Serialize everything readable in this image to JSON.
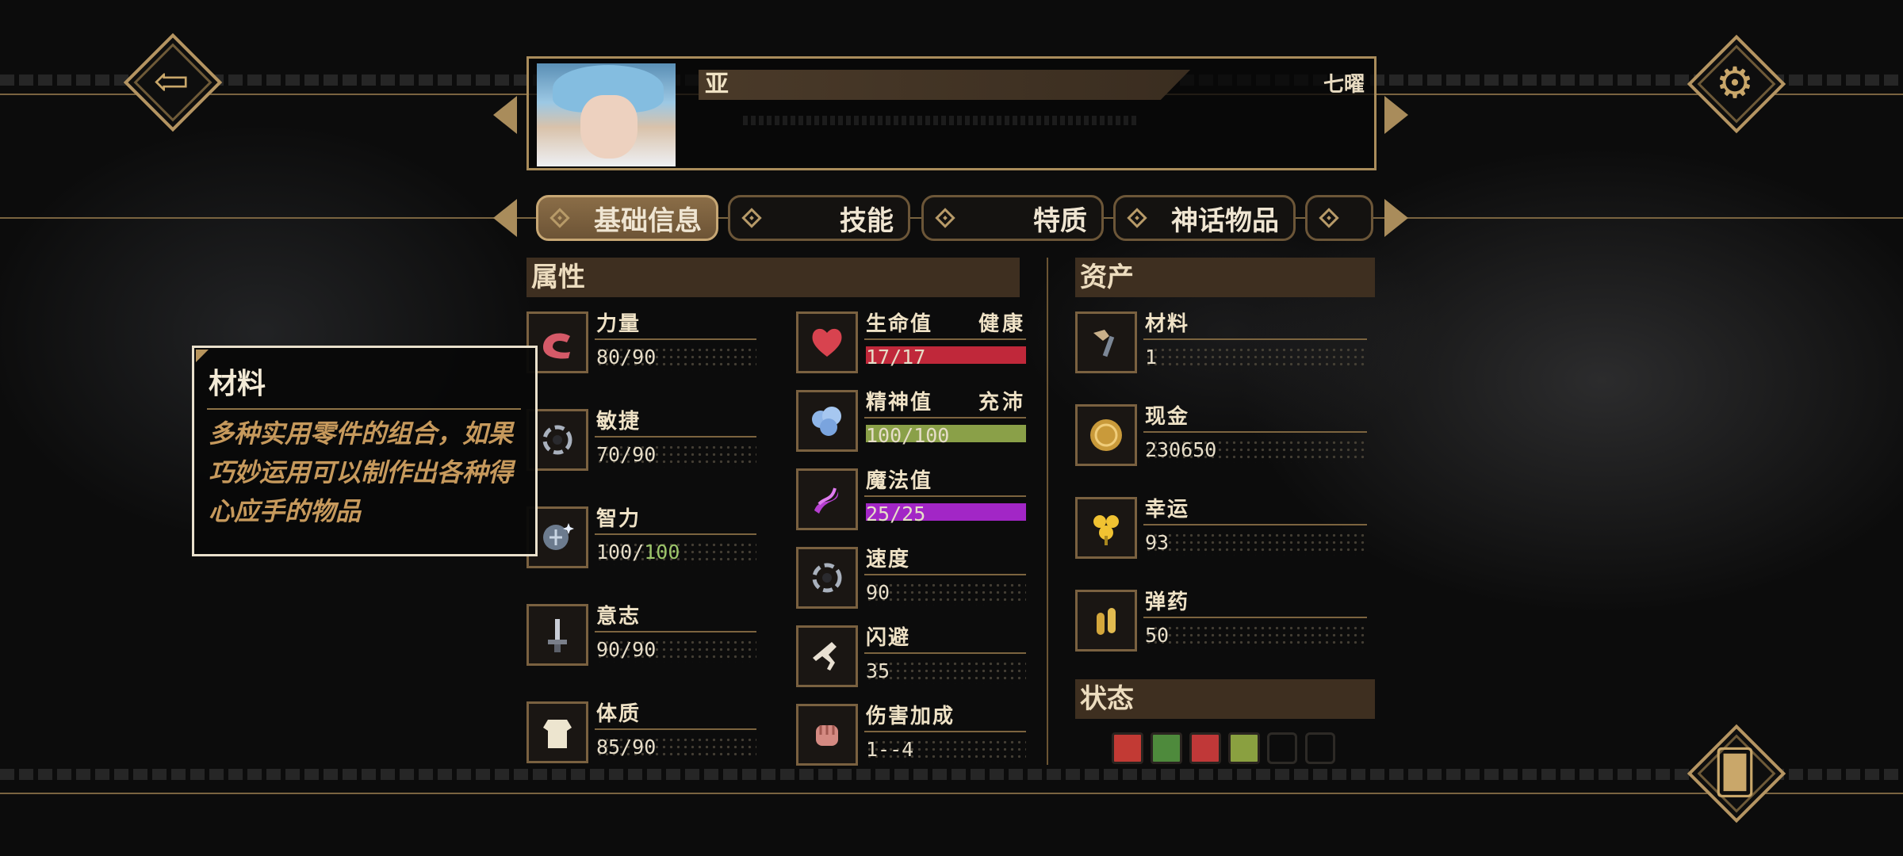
{
  "header": {
    "character_name": "亚",
    "day_label": "七曜"
  },
  "tabs": [
    {
      "label": "基础信息",
      "active": true
    },
    {
      "label": "技能",
      "active": false
    },
    {
      "label": "特质",
      "active": false
    },
    {
      "label": "神话物品",
      "active": false
    },
    {
      "label": "",
      "active": false
    }
  ],
  "attributes": {
    "title": "属性",
    "items": [
      {
        "label": "力量",
        "value": "80/90",
        "icon": "arm-icon"
      },
      {
        "label": "敏捷",
        "value": "70/90",
        "icon": "swirl-icon"
      },
      {
        "label": "智力",
        "value_current": "100/",
        "value_max": "100",
        "icon": "brain-icon"
      },
      {
        "label": "意志",
        "value": "90/90",
        "icon": "sword-icon"
      },
      {
        "label": "体质",
        "value": "85/90",
        "icon": "body-icon"
      }
    ]
  },
  "vitals": {
    "items": [
      {
        "label": "生命值",
        "status": "健康",
        "value": "17/17",
        "fill": 1.0,
        "color": "#c0283a",
        "icon": "heart-icon"
      },
      {
        "label": "精神值",
        "status": "充沛",
        "value": "100/100",
        "fill": 1.0,
        "color": "#8aa048",
        "icon": "brain-cloud-icon"
      },
      {
        "label": "魔法值",
        "status": "",
        "value": "25/25",
        "fill": 1.0,
        "color": "#a226c6",
        "icon": "magic-swirl-icon"
      },
      {
        "label": "速度",
        "status": "",
        "value": "90",
        "icon": "speed-icon"
      },
      {
        "label": "闪避",
        "status": "",
        "value": "35",
        "icon": "dodge-icon"
      },
      {
        "label": "伤害加成",
        "status": "",
        "value": "1--4",
        "icon": "fist-icon"
      }
    ]
  },
  "assets": {
    "title": "资产",
    "items": [
      {
        "label": "材料",
        "value": "1",
        "icon": "materials-icon"
      },
      {
        "label": "现金",
        "value": "230650",
        "icon": "coin-icon"
      },
      {
        "label": "幸运",
        "value": "93",
        "icon": "clover-icon"
      },
      {
        "label": "弹药",
        "value": "50",
        "icon": "ammo-icon"
      }
    ]
  },
  "status": {
    "title": "状态",
    "effects": [
      {
        "icon": "status-effect-1-icon",
        "color": "#c23a34"
      },
      {
        "icon": "status-effect-2-icon",
        "color": "#4e8a3c"
      },
      {
        "icon": "status-effect-3-icon",
        "color": "#c03838"
      },
      {
        "icon": "status-effect-4-icon",
        "color": "#8aa040"
      }
    ]
  },
  "tooltip": {
    "title": "材料",
    "description": "多种实用零件的组合，如果巧妙运用可以制作出各种得心应手的物品"
  },
  "buttons": {
    "back_icon": "back-arrow-icon",
    "settings_icon": "gear-icon",
    "cards_icon": "cards-icon"
  }
}
